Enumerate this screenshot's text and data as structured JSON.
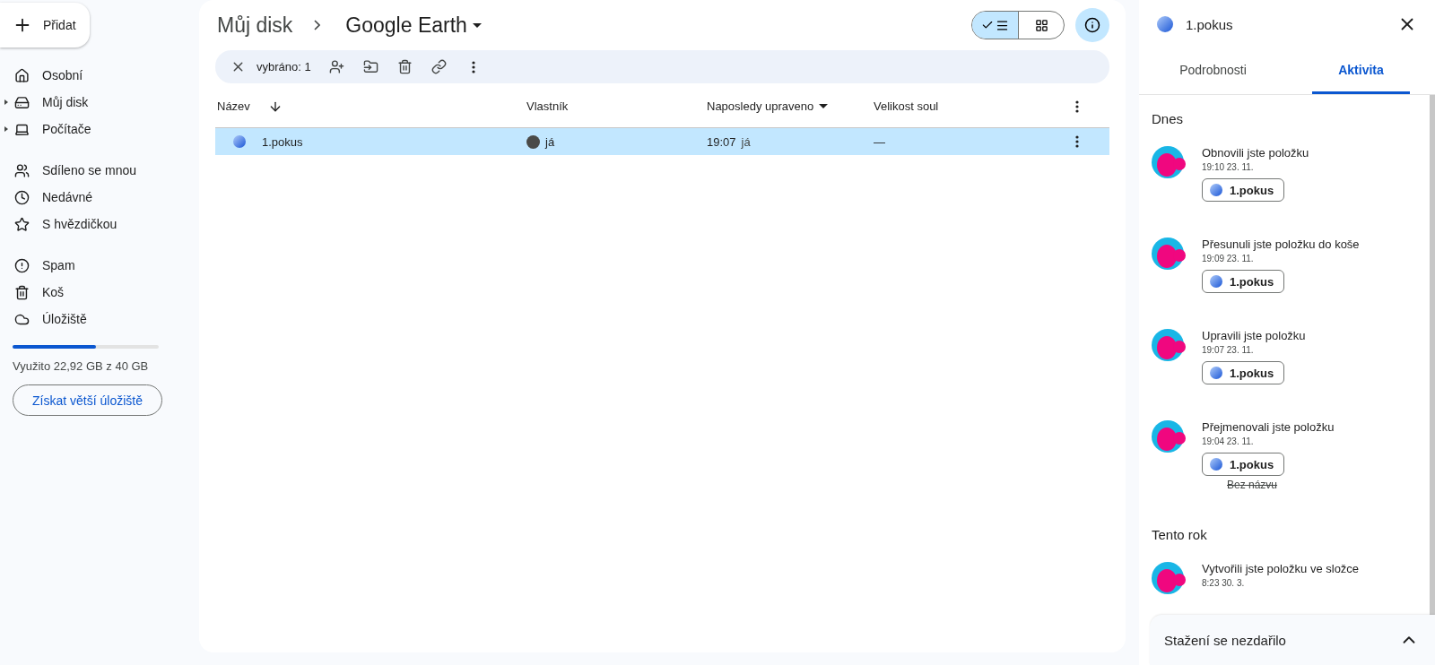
{
  "new_button": {
    "label": "Přidat"
  },
  "sidebar": {
    "sections": [
      [
        {
          "label": "Osobní",
          "expandable": false
        },
        {
          "label": "Můj disk",
          "expandable": true
        },
        {
          "label": "Počítače",
          "expandable": true
        }
      ],
      [
        {
          "label": "Sdíleno se mnou",
          "expandable": false
        },
        {
          "label": "Nedávné",
          "expandable": false
        },
        {
          "label": "S hvězdičkou",
          "expandable": false
        }
      ],
      [
        {
          "label": "Spam",
          "expandable": false
        },
        {
          "label": "Koš",
          "expandable": false
        },
        {
          "label": "Úložiště",
          "expandable": false
        }
      ]
    ]
  },
  "storage": {
    "level": 0.573,
    "usage": "Využito 22,92 GB z 40 GB",
    "button": "Získat větší úložiště"
  },
  "breadcrumb": {
    "parent": "Můj disk",
    "current": "Google Earth"
  },
  "view_toggle": [
    {
      "kind": "list",
      "selected": true
    },
    {
      "kind": "grid",
      "selected": false
    }
  ],
  "selection_bar": {
    "count": "vybráno: 1"
  },
  "table": {
    "columns": [
      {
        "label": "Název",
        "kind": "sort"
      },
      {
        "label": "Vlastník",
        "kind": "plain"
      },
      {
        "label": "Naposledy upraveno",
        "kind": "menu"
      },
      {
        "label": "Velikost soul",
        "kind": "plain"
      }
    ],
    "rows": [
      {
        "name": "1.pokus",
        "owner": "já",
        "modified": "19:07",
        "modified_by": "já",
        "size": "—",
        "selected": true
      }
    ]
  },
  "details": {
    "title": "1.pokus",
    "tabs": [
      {
        "label": "Podrobnosti",
        "selected": false
      },
      {
        "label": "Aktivita",
        "selected": true
      }
    ],
    "groups": [
      {
        "heading": "Dnes",
        "items": [
          {
            "text": "Obnovili jste položku",
            "time": "19:10 23. 11.",
            "file": "1.pokus"
          },
          {
            "text": "Přesunuli jste položku do koše",
            "time": "19:09 23. 11.",
            "file": "1.pokus"
          },
          {
            "text": "Upravili jste položku",
            "time": "19:07 23. 11.",
            "file": "1.pokus"
          },
          {
            "text": "Přejmenovali jste položku",
            "time": "19:04 23. 11.",
            "file": "1.pokus",
            "old_name": "Bez názvu"
          }
        ]
      },
      {
        "heading": "Tento rok",
        "items": [
          {
            "text": "Vytvořili jste položku ve složce",
            "time": "8:23 30. 3."
          }
        ]
      }
    ]
  },
  "download_bar": {
    "title": "Stažení se nezdařilo"
  }
}
